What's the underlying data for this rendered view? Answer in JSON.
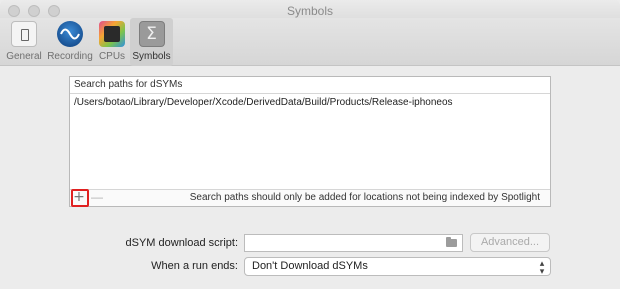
{
  "window": {
    "title": "Symbols"
  },
  "toolbar": {
    "items": [
      {
        "label": "General",
        "icon": "general-settings-icon"
      },
      {
        "label": "Recording",
        "icon": "recording-wave-icon"
      },
      {
        "label": "CPUs",
        "icon": "cpu-icon"
      },
      {
        "label": "Symbols",
        "icon": "sigma-icon",
        "glyph": "Σ",
        "active": true
      }
    ]
  },
  "search_paths": {
    "header": "Search paths for dSYMs",
    "paths": [
      "/Users/botao/Library/Developer/Xcode/DerivedData/Build/Products/Release-iphoneos"
    ],
    "add_label": "+",
    "remove_label": "—",
    "note": "Search paths should only be added for locations not being indexed by Spotlight"
  },
  "download_script": {
    "label": "dSYM download script:",
    "value": "",
    "advanced_label": "Advanced..."
  },
  "run_end": {
    "label": "When a run ends:",
    "selected": "Don't Download dSYMs"
  },
  "colors": {
    "highlight": "#e02020",
    "accent_blue": "#2f8fe0"
  }
}
